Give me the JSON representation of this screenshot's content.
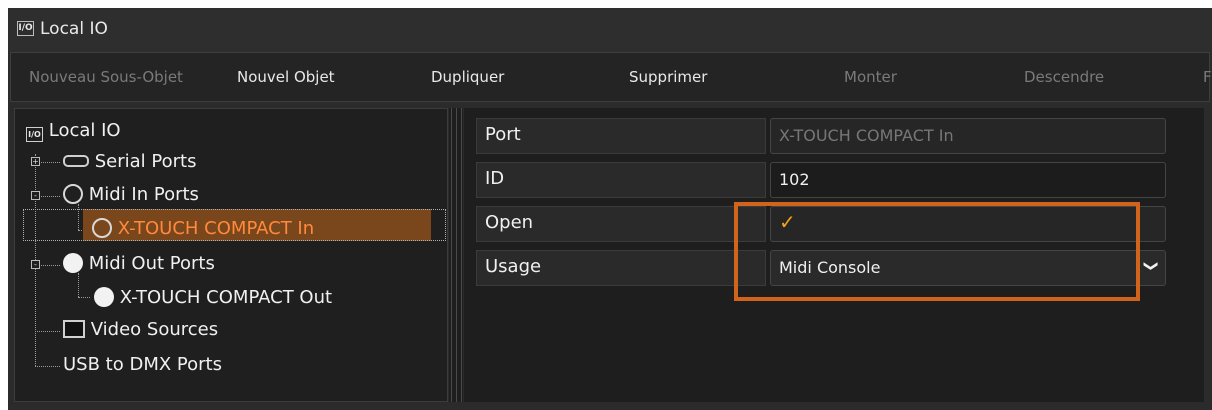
{
  "window": {
    "title": "Local IO",
    "icon_text": "I/O"
  },
  "toolbar": {
    "items": [
      {
        "label": "Nouveau Sous-Objet",
        "enabled": false
      },
      {
        "label": "Nouvel Objet",
        "enabled": true
      },
      {
        "label": "Dupliquer",
        "enabled": true
      },
      {
        "label": "Supprimer",
        "enabled": true
      },
      {
        "label": "Monter",
        "enabled": false
      },
      {
        "label": "Descendre",
        "enabled": false
      },
      {
        "label": "F",
        "enabled": false
      }
    ]
  },
  "tree": {
    "root": "Local IO",
    "nodes": [
      {
        "label": "Serial Ports",
        "icon": "serial-port-icon",
        "expander": "+"
      },
      {
        "label": "Midi In Ports",
        "icon": "midi-in-icon",
        "expander": "-"
      },
      {
        "label": "X-TOUCH COMPACT In",
        "icon": "midi-in-icon",
        "selected": true
      },
      {
        "label": "Midi Out Ports",
        "icon": "midi-out-icon",
        "expander": "-"
      },
      {
        "label": "X-TOUCH COMPACT Out",
        "icon": "midi-out-icon"
      },
      {
        "label": "Video Sources",
        "icon": "video-icon"
      },
      {
        "label": "USB to DMX Ports"
      }
    ]
  },
  "properties": {
    "rows": [
      {
        "name": "Port",
        "value": "X-TOUCH COMPACT In",
        "readonly": true
      },
      {
        "name": "ID",
        "value": "102"
      },
      {
        "name": "Open",
        "checked": true,
        "check_glyph": "✓"
      },
      {
        "name": "Usage",
        "value": "Midi Console",
        "dropdown_glyph": "❯"
      }
    ]
  },
  "colors": {
    "accent": "#d0641c",
    "checkmark": "#f0a11a",
    "selection": "#7a461c",
    "background": "#1e1e1e"
  }
}
